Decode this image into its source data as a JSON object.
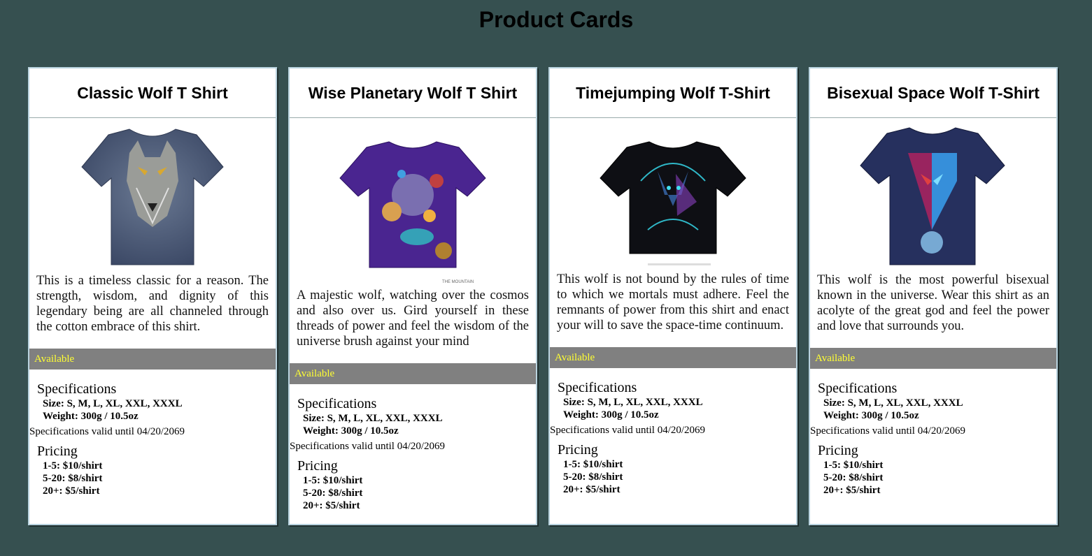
{
  "page": {
    "title": "Product Cards"
  },
  "cards": [
    {
      "title": "Classic Wolf T Shirt",
      "image": {
        "icon": "wolf-tshirt-image",
        "color": "#4a5a78"
      },
      "description": "This is a timeless classic for a reason. The strength, wisdom, and dignity of this legendary being are all channeled through the cotton embrace of this shirt.",
      "availability": "Available",
      "specs_heading": "Specifications",
      "size": "Size: S, M, L, XL, XXL, XXXL",
      "weight": "Weight: 300g / 10.5oz",
      "valid_until": "Specifications valid until 04/20/2069",
      "pricing_heading": "Pricing",
      "prices": [
        "1-5: $10/shirt",
        "5-20: $8/shirt",
        "20+: $5/shirt"
      ]
    },
    {
      "title": "Wise Planetary Wolf T Shirt",
      "image": {
        "icon": "planetary-wolf-tshirt-image",
        "color": "#4a2590",
        "brand": "THE MOUNTAIN"
      },
      "description": "A majestic wolf, watching over the cosmos and also over us. Gird yourself in these threads of power and feel the wisdom of the universe brush against your mind",
      "availability": "Available",
      "specs_heading": "Specifications",
      "size": "Size: S, M, L, XL, XXL, XXXL",
      "weight": "Weight: 300g / 10.5oz",
      "valid_until": "Specifications valid until 04/20/2069",
      "pricing_heading": "Pricing",
      "prices": [
        "1-5: $10/shirt",
        "5-20: $8/shirt",
        "20+: $5/shirt"
      ]
    },
    {
      "title": "Timejumping Wolf T-Shirt",
      "image": {
        "icon": "timejumping-wolf-tshirt-image",
        "color": "#0e0f14"
      },
      "description": "This wolf is not bound by the rules of time to which we mortals must adhere. Feel the remnants of power from this shirt and enact your will to save the space-time continuum.",
      "availability": "Available",
      "specs_heading": "Specifications",
      "size": "Size: S, M, L, XL, XXL, XXXL",
      "weight": "Weight: 300g / 10.5oz",
      "valid_until": "Specifications valid until 04/20/2069",
      "pricing_heading": "Pricing",
      "prices": [
        "1-5: $10/shirt",
        "5-20: $8/shirt",
        "20+: $5/shirt"
      ]
    },
    {
      "title": "Bisexual Space Wolf T-Shirt",
      "image": {
        "icon": "space-wolf-tshirt-image",
        "color": "#26305e"
      },
      "description": "This wolf is the most powerful bisexual known in the universe. Wear this shirt as an acolyte of the great god and feel the power and love that surrounds you.",
      "availability": "Available",
      "specs_heading": "Specifications",
      "size": "Size: S, M, L, XL, XXL, XXXL",
      "weight": "Weight: 300g / 10.5oz",
      "valid_until": "Specifications valid until 04/20/2069",
      "pricing_heading": "Pricing",
      "prices": [
        "1-5: $10/shirt",
        "5-20: $8/shirt",
        "20+: $5/shirt"
      ]
    }
  ]
}
